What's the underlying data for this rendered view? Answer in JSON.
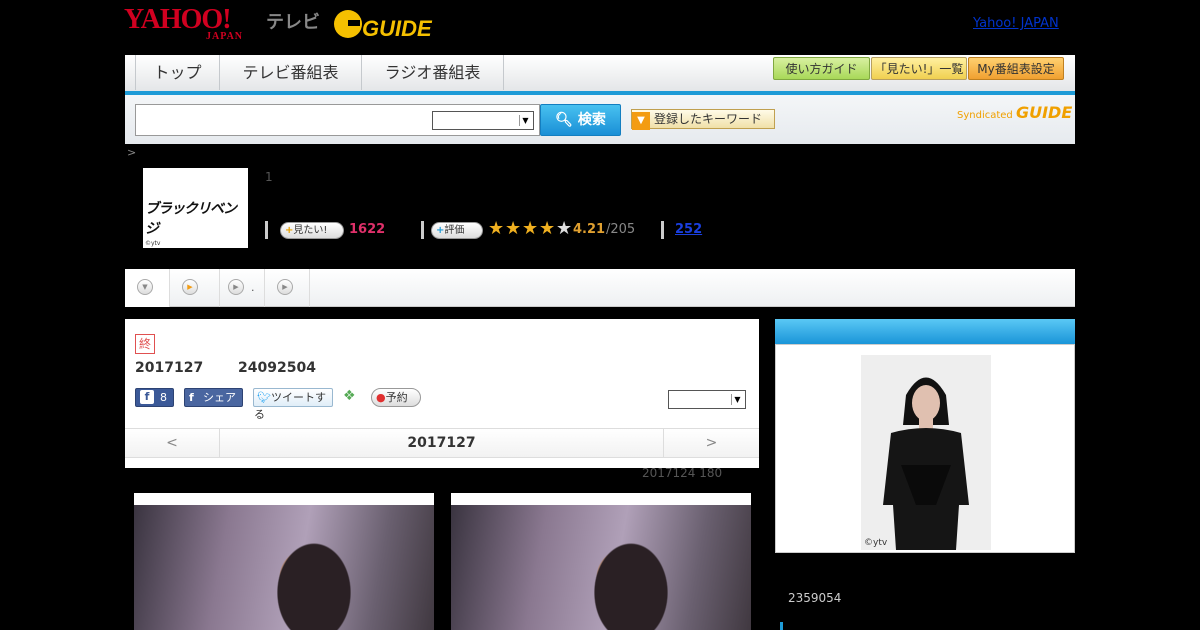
{
  "header": {
    "yahoo_logo": "YAHOO!",
    "yahoo_logo_sub": "JAPAN",
    "tv_label": "テレビ",
    "gguide_logo": "G GUIDE",
    "yahoo_japan_link": "Yahoo! JAPAN"
  },
  "nav": {
    "tabs": [
      {
        "label": "トップ"
      },
      {
        "label": "テレビ番組表"
      },
      {
        "label": "ラジオ番組表"
      }
    ],
    "utility": [
      {
        "label": "使い方ガイド"
      },
      {
        "label": "「見たい!」一覧"
      },
      {
        "label": "My番組表設定"
      }
    ]
  },
  "search": {
    "placeholder": "",
    "button_label": "検索",
    "keyword_button_label": "登録したキーワード",
    "syndicated_label": "Syndicated",
    "syndicated_brand": "GUIDE"
  },
  "breadcrumb": ">",
  "program": {
    "logo_text": "ブラックリベンジ",
    "logo_copyright": "©ytv",
    "number": "1",
    "want_label": "見たい!",
    "want_count": "1622",
    "rate_label": "評価",
    "rating_value": "4.21",
    "rating_total": "/205",
    "rating_stars": 4.21,
    "review_count": "252"
  },
  "tabs": [
    {
      "label": ""
    },
    {
      "label": "."
    },
    {
      "label": ""
    },
    {
      "label": ""
    }
  ],
  "episode": {
    "end_badge": "終",
    "date": "2017127",
    "id": "24092504",
    "fb_like_count": "8",
    "fb_share_label": "シェア",
    "tweet_label": "ツイートする",
    "reserve_label": "予約",
    "nav_prev": "<",
    "nav_current": "2017127",
    "nav_next": ">",
    "update_info": "2017124  180"
  },
  "right": {
    "photo_copyright": "©ytv",
    "id": "2359054"
  },
  "colors": {
    "accent": "#1e9bd7",
    "rating": "#e0a030",
    "want": "#e0306a",
    "link": "#1a3fe0"
  }
}
